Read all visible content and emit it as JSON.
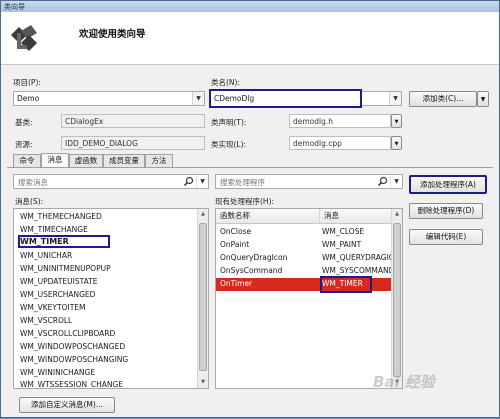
{
  "window": {
    "title": "类向导"
  },
  "header": {
    "title": "欢迎使用类向导"
  },
  "project": {
    "label": "项目(P):",
    "value": "Demo"
  },
  "class_name": {
    "label": "类名(N):",
    "value": "CDemoDlg"
  },
  "add_class_button": {
    "label": "添加类(C)..."
  },
  "base_class": {
    "label": "基类:",
    "value": "CDialogEx"
  },
  "class_declaration": {
    "label": "类声明(T):",
    "value": "demodlg.h"
  },
  "resource": {
    "label": "资源:",
    "value": "IDD_DEMO_DIALOG"
  },
  "class_implementation": {
    "label": "类实现(L):",
    "value": "demodlg.cpp"
  },
  "tabs": [
    {
      "label": "命令"
    },
    {
      "label": "消息"
    },
    {
      "label": "虚函数"
    },
    {
      "label": "成员变量"
    },
    {
      "label": "方法"
    }
  ],
  "search_messages": {
    "placeholder": "搜索消息"
  },
  "search_handlers": {
    "placeholder": "搜索处理程序"
  },
  "messages": {
    "label": "消息(S):",
    "items": [
      "WM_THEMECHANGED",
      "WM_TIMECHANGE",
      "WM_TIMER",
      "WM_UNICHAR",
      "WM_UNINITMENUPOPUP",
      "WM_UPDATEUISTATE",
      "WM_USERCHANGED",
      "WM_VKEYTOITEM",
      "WM_VSCROLL",
      "WM_VSCROLLCLIPBOARD",
      "WM_WINDOWPOSCHANGED",
      "WM_WINDOWPOSCHANGING",
      "WM_WININICHANGE",
      "WM_WTSSESSION_CHANGE"
    ],
    "selected": "WM_TIMER"
  },
  "handlers": {
    "label": "现有处理程序(H):",
    "columns": [
      "函数名称",
      "消息"
    ],
    "rows": [
      {
        "name": "OnClose",
        "message": "WM_CLOSE"
      },
      {
        "name": "OnPaint",
        "message": "WM_PAINT"
      },
      {
        "name": "OnQueryDragIcon",
        "message": "WM_QUERYDRAGICON"
      },
      {
        "name": "OnSysCommand",
        "message": "WM_SYSCOMMAND"
      },
      {
        "name": "OnTimer",
        "message": "WM_TIMER"
      }
    ],
    "selected": "OnTimer"
  },
  "buttons": {
    "add_handler": "添加处理程序(A)",
    "delete_handler": "删除处理程序(D)",
    "edit_code": "编辑代码(E)",
    "add_custom_message": "添加自定义消息(M)..."
  },
  "watermark": "Bai 经验",
  "colors": {
    "selection_red": "#d9281e",
    "highlight_box": "#1c1c8a"
  }
}
